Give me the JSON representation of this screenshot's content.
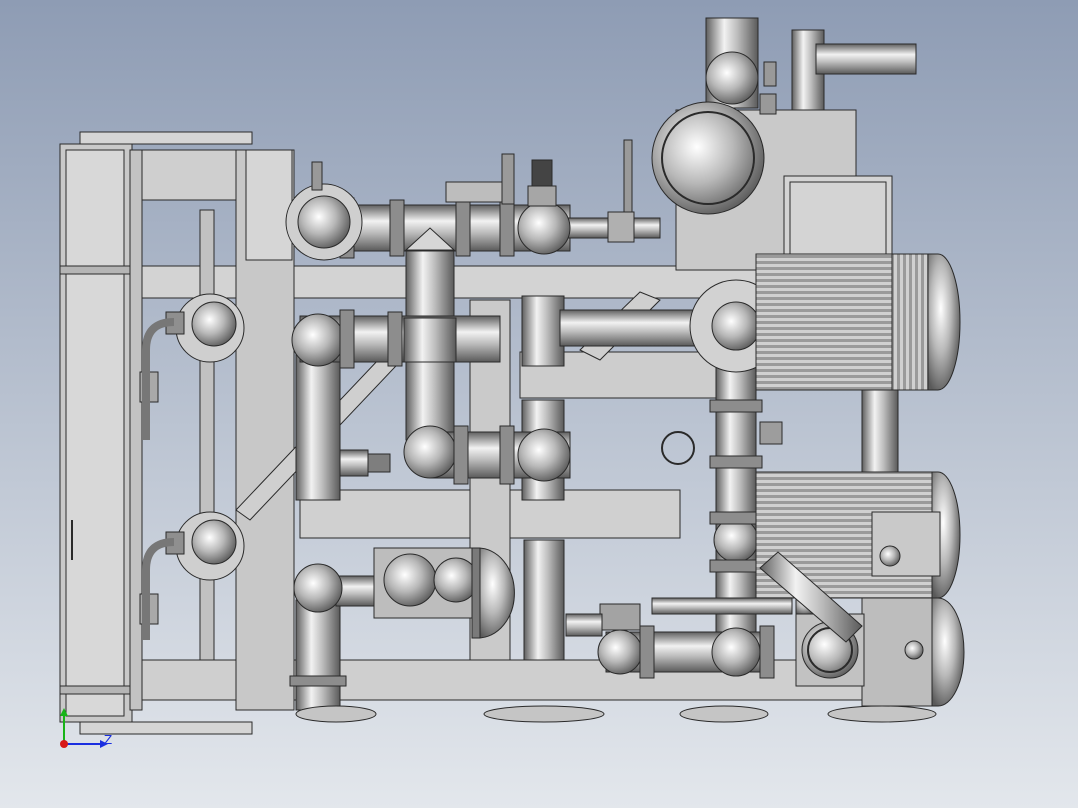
{
  "viewport": {
    "background_top": "#8e9cb4",
    "background_bottom": "#e3e7ec"
  },
  "colors": {
    "metal_dark": "#5f5f5f",
    "metal_mid": "#a9a9a9",
    "metal_light": "#f2f2f2",
    "outline": "#2a2a2a",
    "frame": "#c9c9c9"
  },
  "triad": {
    "z_label": "Z",
    "z_color": "#1a2fe0",
    "y_color": "#18b418",
    "x_color": "#d81818"
  }
}
